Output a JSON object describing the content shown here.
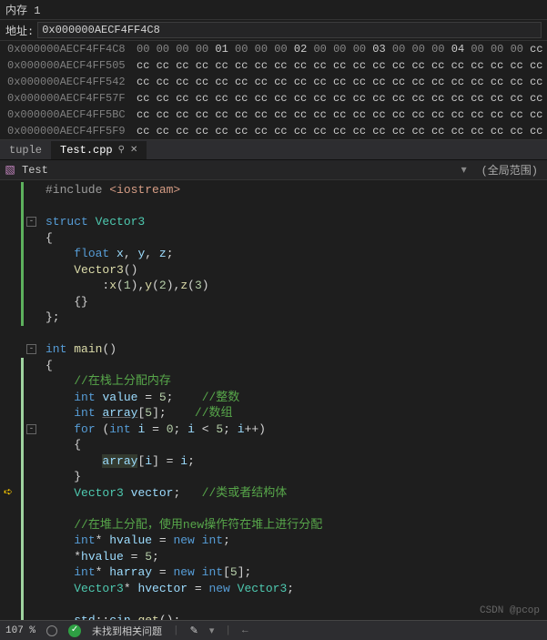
{
  "memory": {
    "panel_title": "内存 1",
    "address_label": "地址:",
    "address_value": "0x000000AECF4FF4C8",
    "rows": [
      {
        "addr": "0x000000AECF4FF4C8",
        "bytes": "00 00 00 00 01 00 00 00 02 00 00 00 03 00 00 00 04 00 00 00 cc cc"
      },
      {
        "addr": "0x000000AECF4FF505",
        "bytes": "cc cc cc cc cc cc cc cc cc cc cc cc cc cc cc cc cc cc cc cc cc cc"
      },
      {
        "addr": "0x000000AECF4FF542",
        "bytes": "cc cc cc cc cc cc cc cc cc cc cc cc cc cc cc cc cc cc cc cc cc cc"
      },
      {
        "addr": "0x000000AECF4FF57F",
        "bytes": "cc cc cc cc cc cc cc cc cc cc cc cc cc cc cc cc cc cc cc cc cc cc"
      },
      {
        "addr": "0x000000AECF4FF5BC",
        "bytes": "cc cc cc cc cc cc cc cc cc cc cc cc cc cc cc cc cc cc cc cc cc cc"
      },
      {
        "addr": "0x000000AECF4FF5F9",
        "bytes": "cc cc cc cc cc cc cc cc cc cc cc cc cc cc cc cc cc cc cc cc cc cc"
      }
    ]
  },
  "tabs": {
    "inactive": [
      "tuple"
    ],
    "active": "Test.cpp",
    "pin": "⚲",
    "close": "✕"
  },
  "navbar": {
    "icon": "▧",
    "current": "Test",
    "scope": "(全局范围)",
    "arrow": "▾"
  },
  "code_tokens": [
    [
      [
        "inc",
        "#include "
      ],
      [
        "str",
        "<iostream>"
      ]
    ],
    [],
    [
      [
        "kw",
        "struct "
      ],
      [
        "typ",
        "Vector3"
      ]
    ],
    [
      [
        "op",
        "{"
      ]
    ],
    [
      [
        "op",
        "    "
      ],
      [
        "kw",
        "float "
      ],
      [
        "var",
        "x"
      ],
      [
        "op",
        ", "
      ],
      [
        "var",
        "y"
      ],
      [
        "op",
        ", "
      ],
      [
        "var",
        "z"
      ],
      [
        "op",
        ";"
      ]
    ],
    [
      [
        "op",
        "    "
      ],
      [
        "fn",
        "Vector3"
      ],
      [
        "op",
        "()"
      ]
    ],
    [
      [
        "op",
        "        :"
      ],
      [
        "fn",
        "x"
      ],
      [
        "op",
        "("
      ],
      [
        "num",
        "1"
      ],
      [
        "op",
        "),"
      ],
      [
        "fn",
        "y"
      ],
      [
        "op",
        "("
      ],
      [
        "num",
        "2"
      ],
      [
        "op",
        "),"
      ],
      [
        "fn",
        "z"
      ],
      [
        "op",
        "("
      ],
      [
        "num",
        "3"
      ],
      [
        "op",
        ")"
      ]
    ],
    [
      [
        "op",
        "    {}"
      ]
    ],
    [
      [
        "op",
        "};"
      ]
    ],
    [],
    [
      [
        "kw",
        "int "
      ],
      [
        "fn",
        "main"
      ],
      [
        "op",
        "()"
      ]
    ],
    [
      [
        "op",
        "{"
      ]
    ],
    [
      [
        "op",
        "    "
      ],
      [
        "cmt",
        "//在栈上分配内存"
      ]
    ],
    [
      [
        "op",
        "    "
      ],
      [
        "kw",
        "int "
      ],
      [
        "var",
        "value"
      ],
      [
        "op",
        " = "
      ],
      [
        "num",
        "5"
      ],
      [
        "op",
        ";    "
      ],
      [
        "cmt",
        "//整数"
      ]
    ],
    [
      [
        "op",
        "    "
      ],
      [
        "kw",
        "int "
      ],
      [
        "varu",
        "array"
      ],
      [
        "op",
        "["
      ],
      [
        "num",
        "5"
      ],
      [
        "op",
        "];    "
      ],
      [
        "cmt",
        "//数组"
      ]
    ],
    [
      [
        "op",
        "    "
      ],
      [
        "kw",
        "for "
      ],
      [
        "op",
        "("
      ],
      [
        "kw",
        "int "
      ],
      [
        "var",
        "i"
      ],
      [
        "op",
        " = "
      ],
      [
        "num",
        "0"
      ],
      [
        "op",
        "; "
      ],
      [
        "var",
        "i"
      ],
      [
        "op",
        " < "
      ],
      [
        "num",
        "5"
      ],
      [
        "op",
        "; "
      ],
      [
        "var",
        "i"
      ],
      [
        "op",
        "++)"
      ]
    ],
    [
      [
        "op",
        "    {"
      ]
    ],
    [
      [
        "op",
        "        "
      ],
      [
        "varh",
        "array"
      ],
      [
        "op",
        "["
      ],
      [
        "var",
        "i"
      ],
      [
        "op",
        "] = "
      ],
      [
        "var",
        "i"
      ],
      [
        "op",
        ";"
      ]
    ],
    [
      [
        "op",
        "    }"
      ]
    ],
    [
      [
        "op",
        "    "
      ],
      [
        "typ",
        "Vector3"
      ],
      [
        "op",
        " "
      ],
      [
        "var",
        "vector"
      ],
      [
        "op",
        ";   "
      ],
      [
        "cmt",
        "//类或者结构体"
      ]
    ],
    [],
    [
      [
        "op",
        "    "
      ],
      [
        "cmt",
        "//在堆上分配，使用"
      ],
      [
        "cmtk",
        "new"
      ],
      [
        "cmt",
        "操作符在堆上进行分配"
      ]
    ],
    [
      [
        "op",
        "    "
      ],
      [
        "kw",
        "int"
      ],
      [
        "op",
        "* "
      ],
      [
        "var",
        "hvalue"
      ],
      [
        "op",
        " = "
      ],
      [
        "kw",
        "new "
      ],
      [
        "kw",
        "int"
      ],
      [
        "op",
        ";"
      ]
    ],
    [
      [
        "op",
        "    *"
      ],
      [
        "var",
        "hvalue"
      ],
      [
        "op",
        " = "
      ],
      [
        "num",
        "5"
      ],
      [
        "op",
        ";"
      ]
    ],
    [
      [
        "op",
        "    "
      ],
      [
        "kw",
        "int"
      ],
      [
        "op",
        "* "
      ],
      [
        "var",
        "harray"
      ],
      [
        "op",
        " = "
      ],
      [
        "kw",
        "new "
      ],
      [
        "kw",
        "int"
      ],
      [
        "op",
        "["
      ],
      [
        "num",
        "5"
      ],
      [
        "op",
        "];"
      ]
    ],
    [
      [
        "op",
        "    "
      ],
      [
        "typ",
        "Vector3"
      ],
      [
        "op",
        "* "
      ],
      [
        "var",
        "hvector"
      ],
      [
        "op",
        " = "
      ],
      [
        "kw",
        "new "
      ],
      [
        "typ",
        "Vector3"
      ],
      [
        "op",
        ";"
      ]
    ],
    [],
    [
      [
        "op",
        "    "
      ],
      [
        "var",
        "std"
      ],
      [
        "op",
        "::"
      ],
      [
        "var",
        "cin"
      ],
      [
        "op",
        "."
      ],
      [
        "fn",
        "get"
      ],
      [
        "op",
        "();"
      ]
    ],
    [
      [
        "op",
        "}"
      ]
    ]
  ],
  "breakpoints": {
    "current_exec_line": 19
  },
  "folds": [
    {
      "line": 2,
      "sym": "-"
    },
    {
      "line": 10,
      "sym": "-"
    },
    {
      "line": 15,
      "sym": "-"
    }
  ],
  "change_bars": [
    {
      "from": 0,
      "to": 8,
      "cls": "bar-seg"
    },
    {
      "from": 11,
      "to": 28,
      "cls": "bar-seg h"
    }
  ],
  "statusbar": {
    "zoom": "107 %",
    "no_issues": "未找到相关问题",
    "check": "✓",
    "brush": "✎",
    "sep": "|",
    "arrow_l": "←"
  },
  "watermark": "CSDN @pcop"
}
